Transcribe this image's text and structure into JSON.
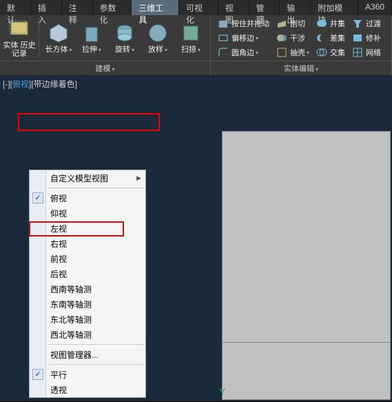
{
  "tabs": [
    "默认",
    "插入",
    "注释",
    "参数化",
    "三维工具",
    "可视化",
    "视图",
    "管理",
    "输出",
    "附加模块",
    "A360"
  ],
  "activeTabIndex": 4,
  "ribbon": {
    "panel1": {
      "title": "建模",
      "big": [
        {
          "label": "实体\n历史记录"
        },
        {
          "label": "长方体"
        },
        {
          "label": "拉伸"
        },
        {
          "label": "旋转"
        },
        {
          "label": "放样"
        },
        {
          "label": "扫掠"
        }
      ]
    },
    "panel2": {
      "title": "实体编辑",
      "rows": [
        [
          {
            "label": "按住并拖动"
          },
          {
            "label": "剖切"
          },
          {
            "label": "并集"
          },
          {
            "label": "过渡"
          }
        ],
        [
          {
            "label": "偏移边"
          },
          {
            "label": "干涉"
          },
          {
            "label": "差集"
          },
          {
            "label": "修补"
          }
        ],
        [
          {
            "label": "圆角边"
          },
          {
            "label": "抽壳"
          },
          {
            "label": "交集"
          },
          {
            "label": "网络"
          }
        ]
      ]
    }
  },
  "viewLabel": {
    "prefix": "[-][",
    "view": "俯视",
    "suffix": "][带边缘着色]"
  },
  "contextMenu": {
    "topItem": "自定义模型视图",
    "items": [
      "俯视",
      "仰视",
      "左视",
      "右视",
      "前视",
      "后视",
      "西南等轴测",
      "东南等轴测",
      "东北等轴测",
      "西北等轴测"
    ],
    "checkedIndex": 0,
    "manager": "视图管理器...",
    "projection": [
      "平行",
      "透视"
    ],
    "projectionChecked": 0
  },
  "ucs": "Y"
}
